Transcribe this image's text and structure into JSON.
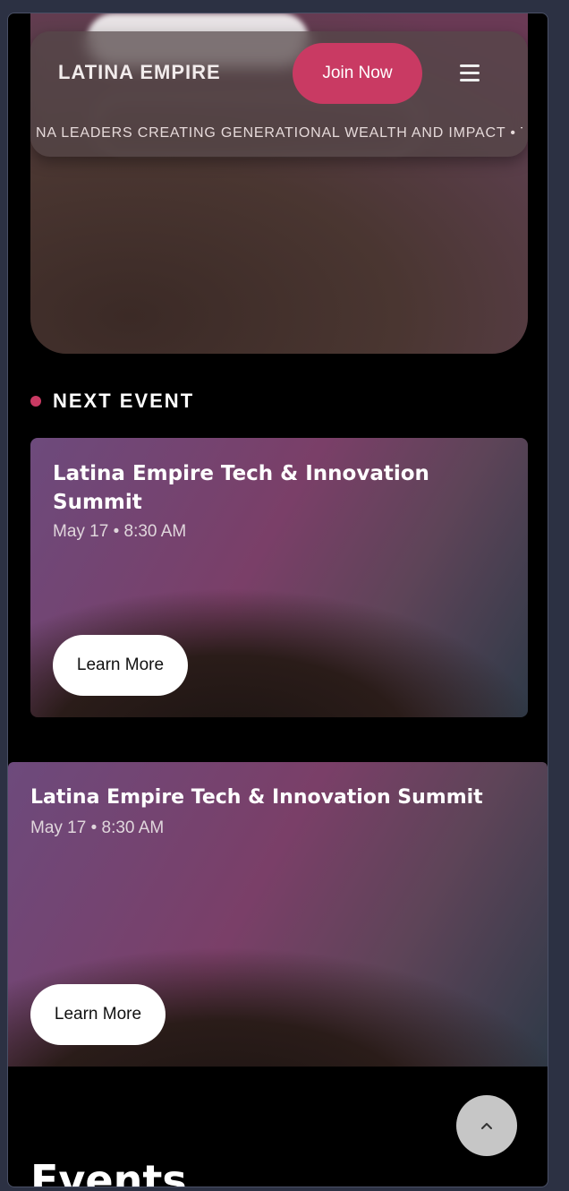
{
  "header": {
    "brand": "LATINA EMPIRE",
    "join_label": "Join Now",
    "ticker": "NA LEADERS CREATING GENERATIONAL WEALTH AND IMPACT • TF"
  },
  "next_event": {
    "label": "NEXT EVENT"
  },
  "events": [
    {
      "title": "Latina Empire Tech & Innovation Summit",
      "date": "May 17 • 8:30 AM",
      "button": "Learn More"
    },
    {
      "title": "Latina Empire Tech & Innovation Summit",
      "date": "May 17 • 8:30 AM",
      "button": "Learn More"
    }
  ],
  "section": {
    "heading": "Events"
  },
  "colors": {
    "accent": "#c93a63",
    "background": "#000000",
    "outer_background": "#2c3143"
  },
  "icons": {
    "menu": "hamburger-icon",
    "scroll_top": "chevron-up-icon"
  }
}
